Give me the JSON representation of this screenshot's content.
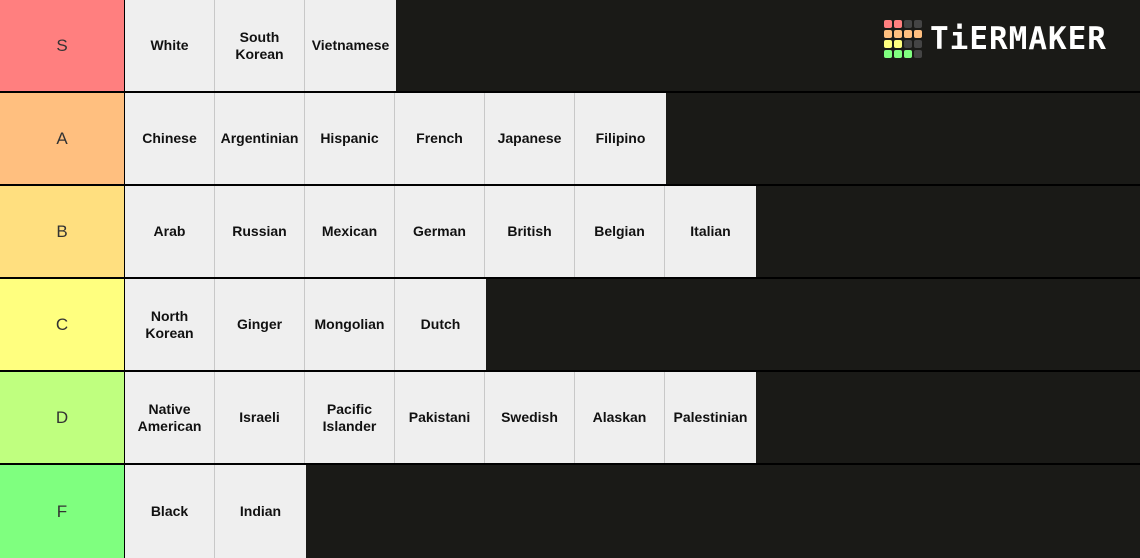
{
  "logo": {
    "text": "TiERMAKER",
    "grid_colors": [
      "#ff7f7f",
      "#ff7f7f",
      "#444444",
      "#444444",
      "#ffbf7f",
      "#ffbf7f",
      "#ffbf7f",
      "#ffbf7f",
      "#ffff7f",
      "#ffff7f",
      "#444444",
      "#444444",
      "#7fff7f",
      "#7fff7f",
      "#7fff7f",
      "#444444"
    ]
  },
  "tiers": [
    {
      "label": "S",
      "color": "#ff7f7f",
      "items": [
        "White",
        "South Korean",
        "Vietnamese"
      ]
    },
    {
      "label": "A",
      "color": "#ffbf7f",
      "items": [
        "Chinese",
        "Argentinian",
        "Hispanic",
        "French",
        "Japanese",
        "Filipino"
      ]
    },
    {
      "label": "B",
      "color": "#ffdf7f",
      "items": [
        "Arab",
        "Russian",
        "Mexican",
        "German",
        "British",
        "Belgian",
        "Italian"
      ]
    },
    {
      "label": "C",
      "color": "#ffff7f",
      "items": [
        "North Korean",
        "Ginger",
        "Mongolian",
        "Dutch"
      ]
    },
    {
      "label": "D",
      "color": "#bfff7f",
      "items": [
        "Native American",
        "Israeli",
        "Pacific Islander",
        "Pakistani",
        "Swedish",
        "Alaskan",
        "Palestinian"
      ]
    },
    {
      "label": "F",
      "color": "#7fff7f",
      "items": [
        "Black",
        "Indian"
      ]
    }
  ]
}
